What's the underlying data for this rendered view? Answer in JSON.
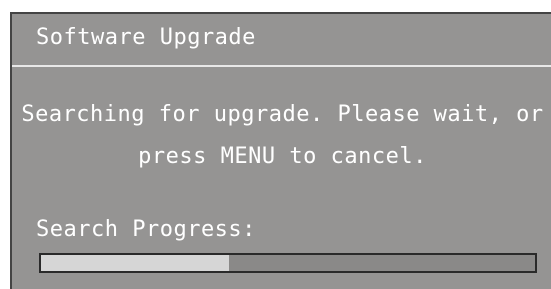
{
  "dialog": {
    "title": "Software Upgrade",
    "message_line1": "Searching for upgrade. Please wait, or",
    "message_line2": "press MENU to cancel.",
    "progress_label": "Search Progress:",
    "progress_value": 0.38
  },
  "colors": {
    "panel_background": "#959493",
    "text": "#ffffff",
    "progress_fill": "#d6d6d6",
    "progress_border": "#2a2a2a"
  }
}
